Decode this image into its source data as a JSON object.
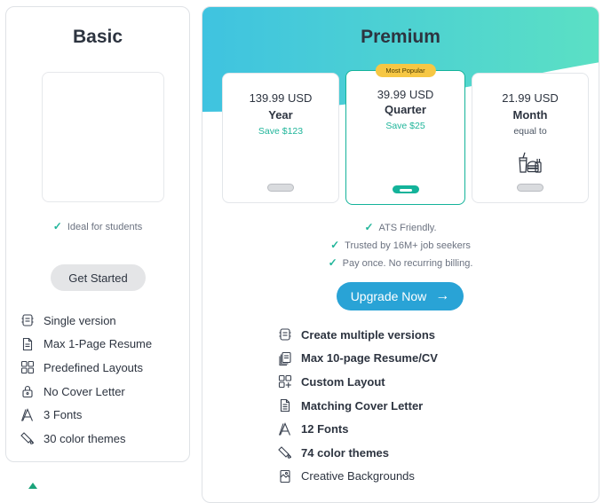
{
  "basic": {
    "title": "Basic",
    "ideal": "Ideal for students",
    "cta": "Get Started",
    "features": [
      {
        "label": "Single version",
        "icon": "single-version-icon"
      },
      {
        "label": "Max 1-Page Resume",
        "icon": "document-icon"
      },
      {
        "label": "Predefined Layouts",
        "icon": "layout-icon"
      },
      {
        "label": "No Cover Letter",
        "icon": "lock-icon"
      },
      {
        "label": "3 Fonts",
        "icon": "font-icon"
      },
      {
        "label": "30 color themes",
        "icon": "palette-icon"
      }
    ]
  },
  "premium": {
    "title": "Premium",
    "plans": [
      {
        "price": "139.99 USD",
        "period": "Year",
        "save": "Save $123"
      },
      {
        "badge": "Most Popular",
        "price": "39.99 USD",
        "period": "Quarter",
        "save": "Save $25"
      },
      {
        "price": "21.99 USD",
        "period": "Month",
        "note": "equal to",
        "icon": "fast-food-icon"
      }
    ],
    "perks": [
      "ATS Friendly.",
      "Trusted by 16M+ job seekers",
      "Pay once. No recurring billing."
    ],
    "cta": "Upgrade Now",
    "features": [
      {
        "label": "Create multiple versions",
        "icon": "multiple-versions-icon"
      },
      {
        "label": "Max 10-page Resume/CV",
        "icon": "pages-icon"
      },
      {
        "label": "Custom Layout",
        "icon": "custom-layout-icon"
      },
      {
        "label": "Matching Cover Letter",
        "icon": "cover-letter-icon"
      },
      {
        "label": "12 Fonts",
        "icon": "font-icon"
      },
      {
        "label": "74 color themes",
        "icon": "palette-icon"
      },
      {
        "label": "Creative Backgrounds",
        "icon": "background-icon"
      }
    ]
  },
  "colors": {
    "accent_green": "#20b59a",
    "cta_blue": "#29a3d6",
    "badge_yellow": "#f6c744",
    "gradient_start": "#3fc3e0",
    "gradient_end": "#5be0c4"
  }
}
